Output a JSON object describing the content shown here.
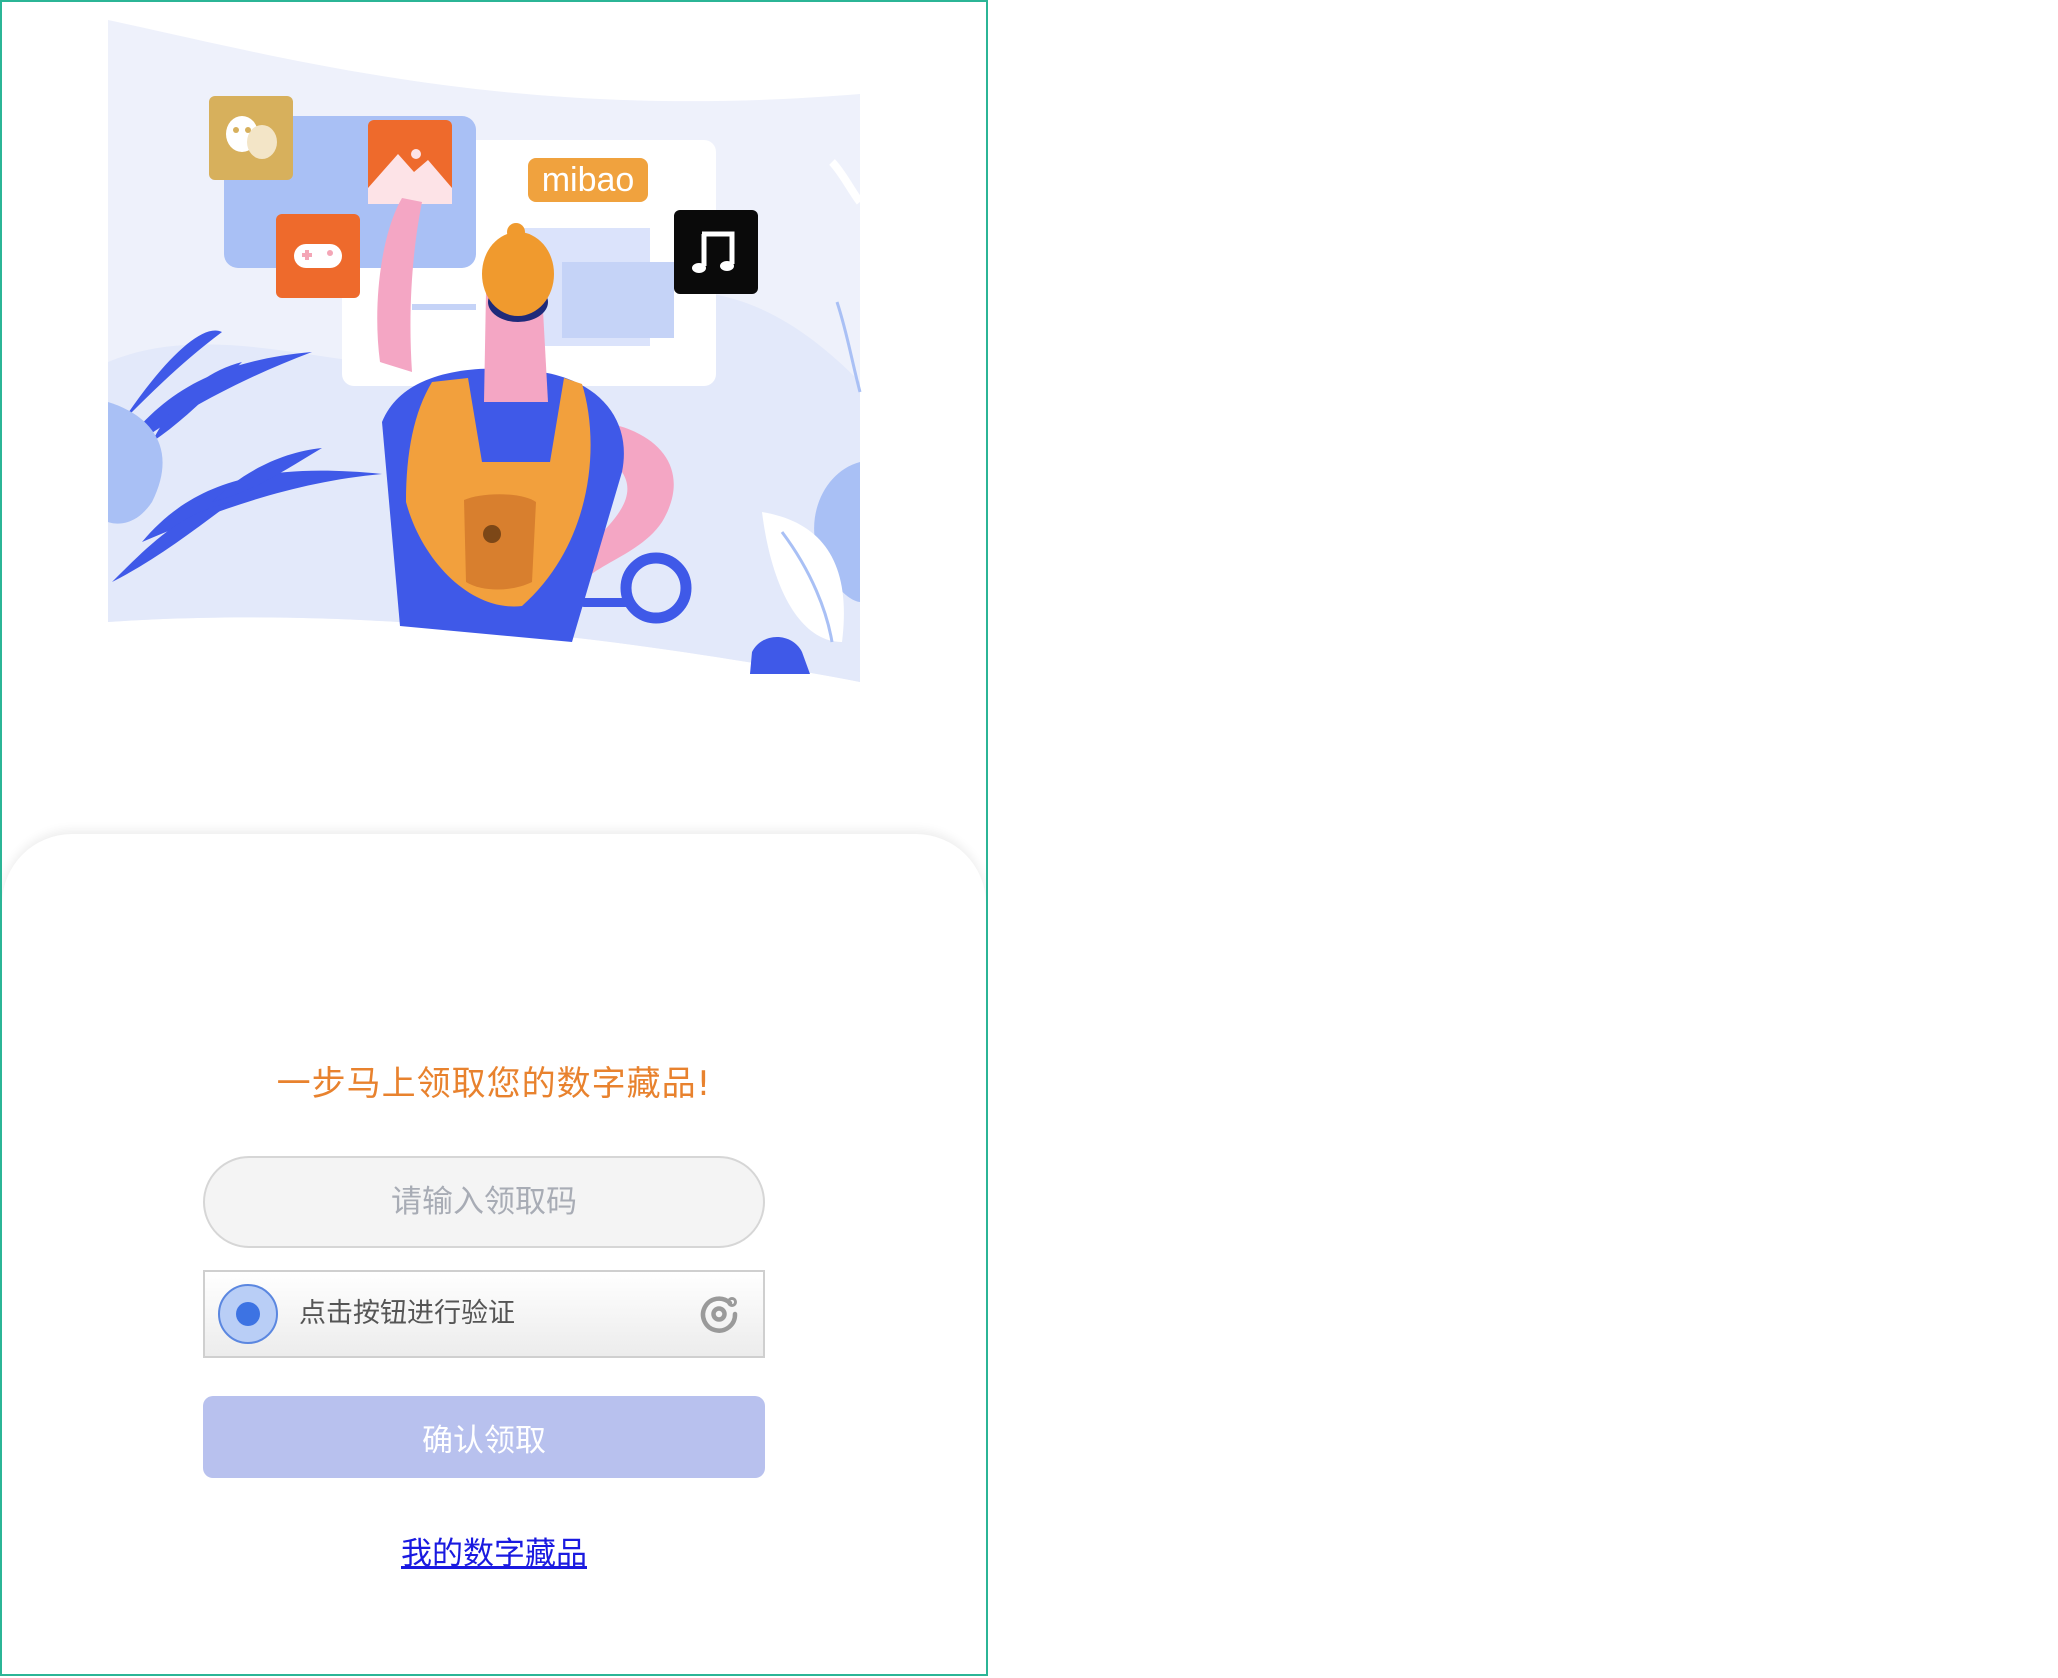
{
  "hero": {
    "badge_text": "mibao",
    "icons": [
      "theater-masks-icon",
      "picture-icon",
      "gamepad-icon",
      "music-note-icon",
      "magnifier-icon"
    ]
  },
  "form": {
    "headline": "一步马上领取您的数字藏品!",
    "code_input_placeholder": "请输入领取码",
    "captcha_label": "点击按钮进行验证",
    "confirm_label": "确认领取",
    "my_collection_link": "我的数字藏品"
  },
  "colors": {
    "frame_border": "#2bb596",
    "headline": "#e8822e",
    "button_disabled": "#b8c1ee",
    "link": "#1a1ae0",
    "accent_blue": "#3d5ae8",
    "accent_orange": "#f2a03d"
  }
}
